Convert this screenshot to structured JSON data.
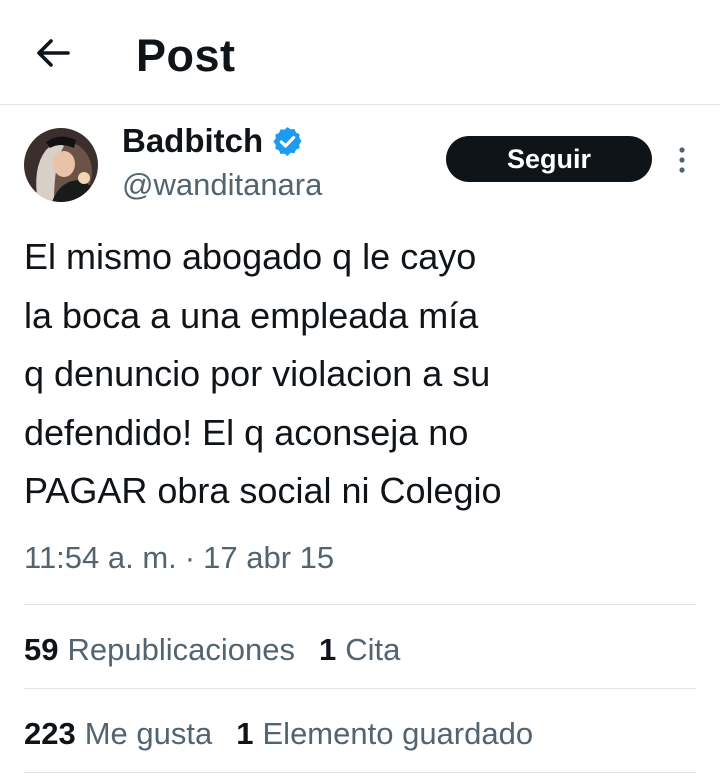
{
  "header": {
    "title": "Post",
    "back_icon": "arrow-left-icon"
  },
  "author": {
    "display_name": "Badbitch",
    "handle": "@wanditanara",
    "verified": true,
    "verified_color": "#1d9bf0",
    "avatar_icon": "avatar-photo"
  },
  "follow_button": {
    "label": "Seguir"
  },
  "more_icon": "more-vertical-icon",
  "tweet": {
    "lines": [
      "El mismo abogado q le cayo",
      "la boca a una empleada mía",
      "q denuncio por violacion a su",
      "defendido! El q aconseja no",
      "PAGAR obra social ni Colegio"
    ],
    "time": "11:54 a. m.",
    "separator": "·",
    "date": "17 abr 15"
  },
  "stats": {
    "reposts": {
      "count": "59",
      "label": "Republicaciones"
    },
    "quotes": {
      "count": "1",
      "label": "Cita"
    },
    "likes": {
      "count": "223",
      "label": "Me gusta"
    },
    "bookmarks": {
      "count": "1",
      "label": "Elemento guardado"
    }
  }
}
